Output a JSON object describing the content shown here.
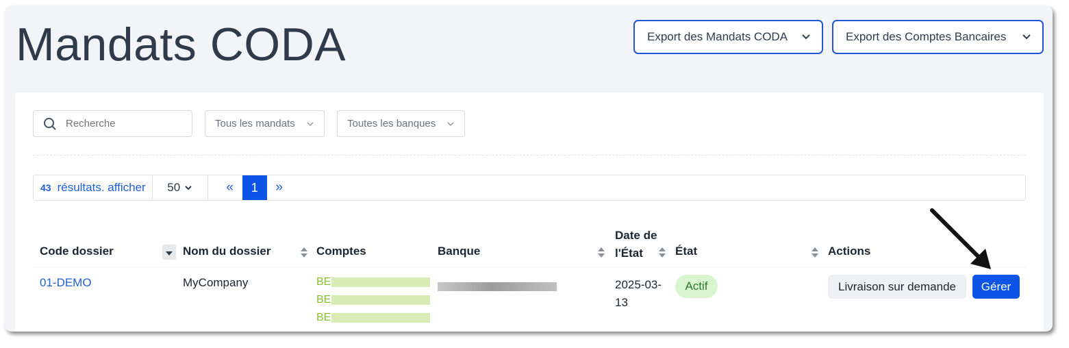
{
  "page": {
    "title": "Mandats CODA"
  },
  "exports": {
    "mandats_label": "Export des Mandats CODA",
    "comptes_label": "Export des Comptes Bancaires"
  },
  "filters": {
    "search_placeholder": "Recherche",
    "mandats_select": "Tous les mandats",
    "banques_select": "Toutes les banques"
  },
  "pager": {
    "count": "43",
    "count_text": "résultats. afficher",
    "per_page": "50",
    "prev": "«",
    "current_page": "1",
    "next": "»"
  },
  "table": {
    "headers": {
      "code": "Code dossier",
      "nom": "Nom du dossier",
      "comptes": "Comptes",
      "banque": "Banque",
      "date_line1": "Date de",
      "date_line2": "l'État",
      "etat": "État",
      "actions": "Actions"
    },
    "rows": [
      {
        "code": "01-DEMO",
        "nom": "MyCompany",
        "comptes": [
          "BE",
          "BE",
          "BE"
        ],
        "date_line1": "2025-03-",
        "date_line2": "13",
        "etat": "Actif",
        "action_livraison": "Livraison sur demande",
        "action_gerer": "Gérer"
      }
    ]
  },
  "colors": {
    "accent": "#0d55e6",
    "link": "#1f5fd6",
    "account_green": "#86c232",
    "status_bg": "#d9f5cf"
  },
  "icons": [
    "search-icon",
    "chevron-down-icon",
    "sort-icon",
    "pointer-arrow-icon"
  ]
}
